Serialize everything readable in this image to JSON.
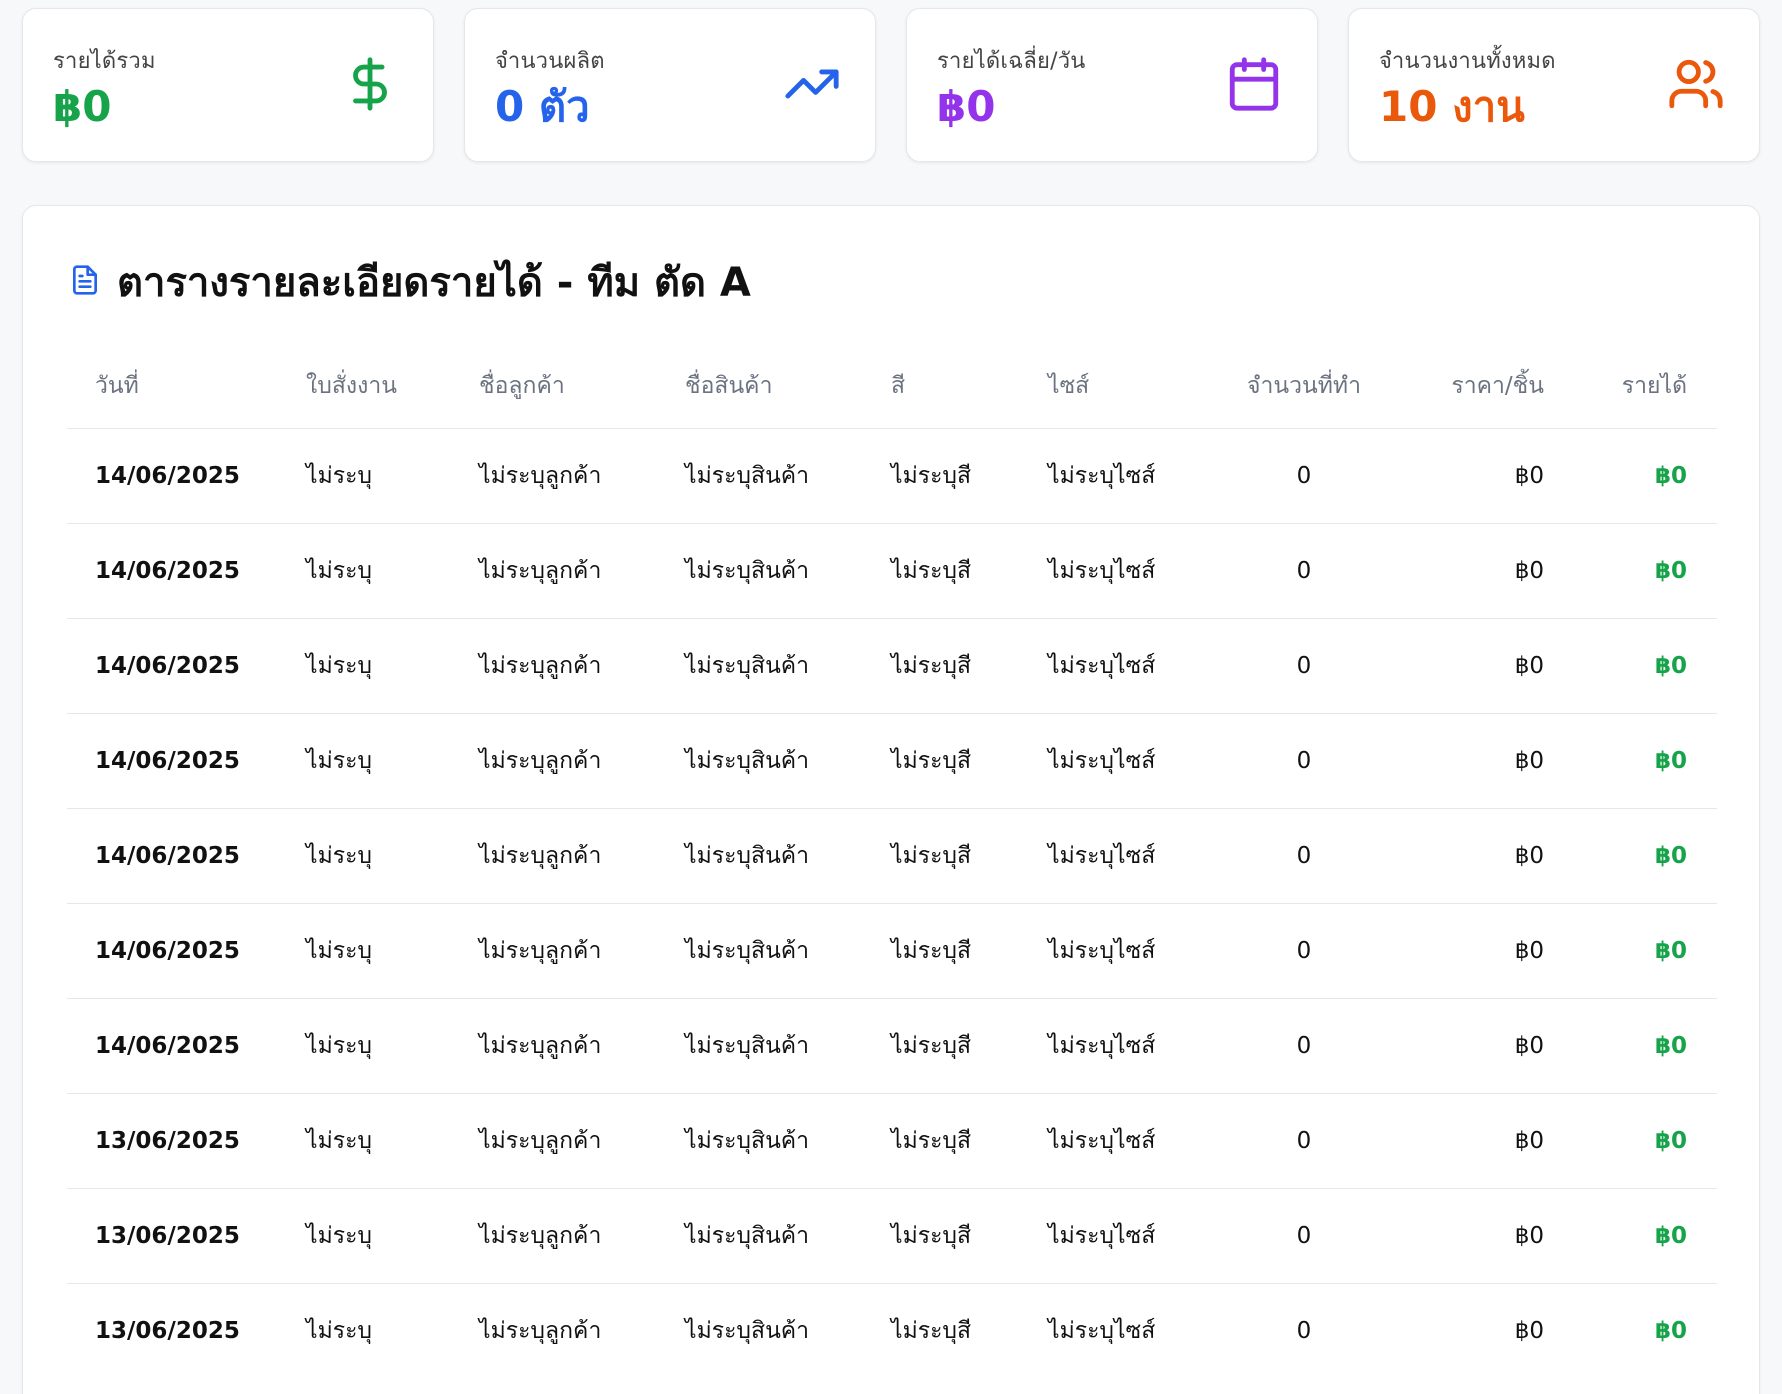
{
  "stats": [
    {
      "label": "รายได้รวม",
      "value": "฿0",
      "color": "#16a34a",
      "icon": "dollar-icon"
    },
    {
      "label": "จำนวนผลิต",
      "value": "0 ตัว",
      "color": "#2563eb",
      "icon": "trending-up-icon"
    },
    {
      "label": "รายได้เฉลี่ย/วัน",
      "value": "฿0",
      "color": "#9333ea",
      "icon": "calendar-icon"
    },
    {
      "label": "จำนวนงานทั้งหมด",
      "value": "10 งาน",
      "color": "#ea580c",
      "icon": "users-icon"
    }
  ],
  "table": {
    "title": "ตารางรายละเอียดรายได้ - ทีม ตัด A",
    "title_icon": "document-icon",
    "columns": [
      "วันที่",
      "ใบสั่งงาน",
      "ชื่อลูกค้า",
      "ชื่อสินค้า",
      "สี",
      "ไซส์",
      "จำนวนที่ทำ",
      "ราคา/ชิ้น",
      "รายได้"
    ],
    "rows": [
      [
        "14/06/2025",
        "ไม่ระบุ",
        "ไม่ระบุลูกค้า",
        "ไม่ระบุสินค้า",
        "ไม่ระบุสี",
        "ไม่ระบุไซส์",
        "0",
        "฿0",
        "฿0"
      ],
      [
        "14/06/2025",
        "ไม่ระบุ",
        "ไม่ระบุลูกค้า",
        "ไม่ระบุสินค้า",
        "ไม่ระบุสี",
        "ไม่ระบุไซส์",
        "0",
        "฿0",
        "฿0"
      ],
      [
        "14/06/2025",
        "ไม่ระบุ",
        "ไม่ระบุลูกค้า",
        "ไม่ระบุสินค้า",
        "ไม่ระบุสี",
        "ไม่ระบุไซส์",
        "0",
        "฿0",
        "฿0"
      ],
      [
        "14/06/2025",
        "ไม่ระบุ",
        "ไม่ระบุลูกค้า",
        "ไม่ระบุสินค้า",
        "ไม่ระบุสี",
        "ไม่ระบุไซส์",
        "0",
        "฿0",
        "฿0"
      ],
      [
        "14/06/2025",
        "ไม่ระบุ",
        "ไม่ระบุลูกค้า",
        "ไม่ระบุสินค้า",
        "ไม่ระบุสี",
        "ไม่ระบุไซส์",
        "0",
        "฿0",
        "฿0"
      ],
      [
        "14/06/2025",
        "ไม่ระบุ",
        "ไม่ระบุลูกค้า",
        "ไม่ระบุสินค้า",
        "ไม่ระบุสี",
        "ไม่ระบุไซส์",
        "0",
        "฿0",
        "฿0"
      ],
      [
        "14/06/2025",
        "ไม่ระบุ",
        "ไม่ระบุลูกค้า",
        "ไม่ระบุสินค้า",
        "ไม่ระบุสี",
        "ไม่ระบุไซส์",
        "0",
        "฿0",
        "฿0"
      ],
      [
        "13/06/2025",
        "ไม่ระบุ",
        "ไม่ระบุลูกค้า",
        "ไม่ระบุสินค้า",
        "ไม่ระบุสี",
        "ไม่ระบุไซส์",
        "0",
        "฿0",
        "฿0"
      ],
      [
        "13/06/2025",
        "ไม่ระบุ",
        "ไม่ระบุลูกค้า",
        "ไม่ระบุสินค้า",
        "ไม่ระบุสี",
        "ไม่ระบุไซส์",
        "0",
        "฿0",
        "฿0"
      ],
      [
        "13/06/2025",
        "ไม่ระบุ",
        "ไม่ระบุลูกค้า",
        "ไม่ระบุสินค้า",
        "ไม่ระบุสี",
        "ไม่ระบุไซส์",
        "0",
        "฿0",
        "฿0"
      ]
    ]
  }
}
